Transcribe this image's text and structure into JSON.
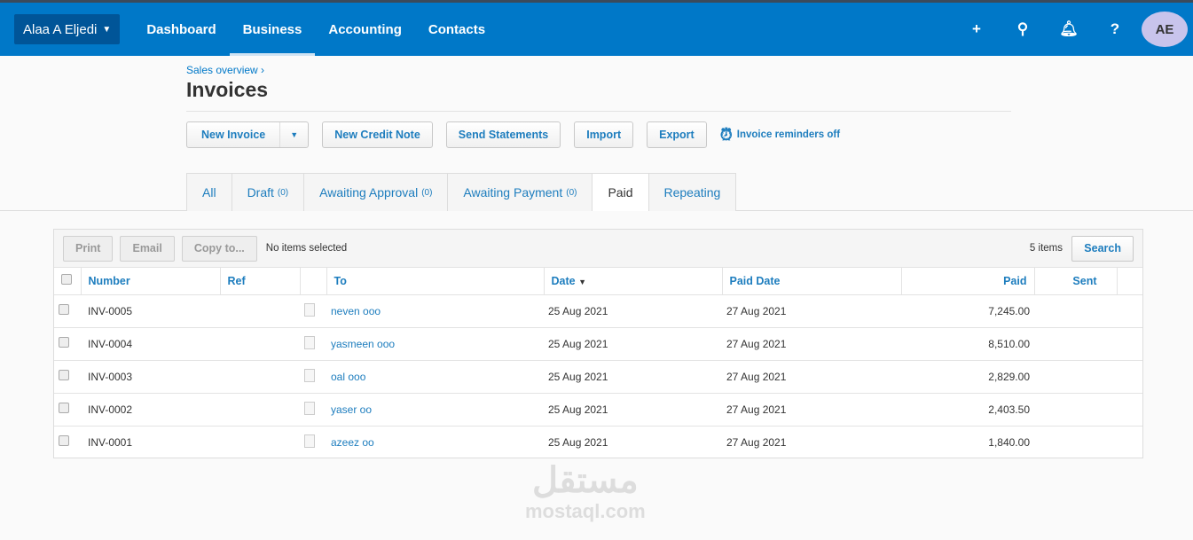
{
  "nav": {
    "org": "Alaa A Eljedi",
    "items": [
      "Dashboard",
      "Business",
      "Accounting",
      "Contacts"
    ],
    "active": "Business",
    "avatar": "AE"
  },
  "page": {
    "breadcrumb": "Sales overview ›",
    "title": "Invoices"
  },
  "actions": {
    "new_invoice": "New Invoice",
    "new_credit_note": "New Credit Note",
    "send_statements": "Send Statements",
    "import": "Import",
    "export": "Export",
    "reminders": "Invoice reminders off"
  },
  "tabs": [
    {
      "label": "All",
      "count": ""
    },
    {
      "label": "Draft",
      "count": "(0)"
    },
    {
      "label": "Awaiting Approval",
      "count": "(0)"
    },
    {
      "label": "Awaiting Payment",
      "count": "(0)"
    },
    {
      "label": "Paid",
      "count": ""
    },
    {
      "label": "Repeating",
      "count": ""
    }
  ],
  "toolbar": {
    "print": "Print",
    "email": "Email",
    "copy": "Copy to...",
    "selected": "No items selected",
    "count": "5 items",
    "search": "Search"
  },
  "columns": {
    "number": "Number",
    "ref": "Ref",
    "to": "To",
    "date": "Date",
    "paid_date": "Paid Date",
    "paid": "Paid",
    "sent": "Sent"
  },
  "rows": [
    {
      "number": "INV-0005",
      "ref": "",
      "to": "neven ooo",
      "date": "25 Aug 2021",
      "paid_date": "27 Aug 2021",
      "paid": "7,245.00",
      "sent": ""
    },
    {
      "number": "INV-0004",
      "ref": "",
      "to": "yasmeen ooo",
      "date": "25 Aug 2021",
      "paid_date": "27 Aug 2021",
      "paid": "8,510.00",
      "sent": ""
    },
    {
      "number": "INV-0003",
      "ref": "",
      "to": "oal ooo",
      "date": "25 Aug 2021",
      "paid_date": "27 Aug 2021",
      "paid": "2,829.00",
      "sent": ""
    },
    {
      "number": "INV-0002",
      "ref": "",
      "to": "yaser oo",
      "date": "25 Aug 2021",
      "paid_date": "27 Aug 2021",
      "paid": "2,403.50",
      "sent": ""
    },
    {
      "number": "INV-0001",
      "ref": "",
      "to": "azeez oo",
      "date": "25 Aug 2021",
      "paid_date": "27 Aug 2021",
      "paid": "1,840.00",
      "sent": ""
    }
  ],
  "watermark": {
    "arabic": "مستقل",
    "latin": "mostaql.com"
  }
}
